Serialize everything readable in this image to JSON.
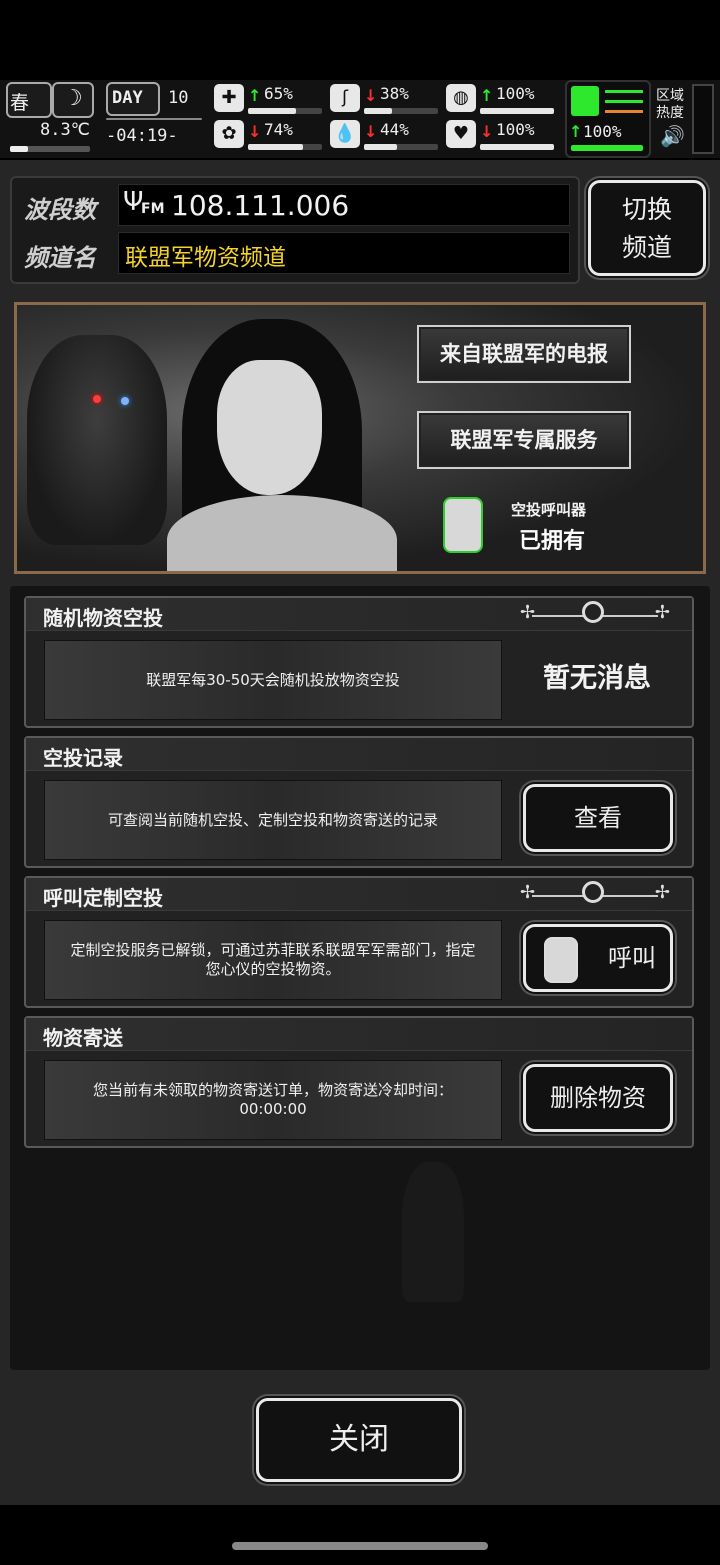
{
  "status": {
    "season": "春",
    "temperature": "8.3℃",
    "day_label": "DAY",
    "day_number": "10",
    "clock": "-04:19-",
    "stats": [
      {
        "icon": "medkit-icon",
        "trend": "up",
        "value": "65%",
        "level": 0.65
      },
      {
        "icon": "stomach-icon",
        "trend": "down",
        "value": "38%",
        "level": 0.38
      },
      {
        "icon": "armor-icon",
        "trend": "up",
        "value": "100%",
        "level": 1.0
      },
      {
        "icon": "brain-icon",
        "trend": "down",
        "value": "74%",
        "level": 0.74
      },
      {
        "icon": "water-drop-icon",
        "trend": "down",
        "value": "44%",
        "level": 0.44
      },
      {
        "icon": "heart-icon",
        "trend": "down",
        "value": "100%",
        "level": 1.0
      }
    ],
    "stamina": {
      "trend": "up",
      "value": "100%",
      "level": 1.0
    },
    "region_heat_label": "区域热度"
  },
  "radio": {
    "band_label": "波段数",
    "band_icon": "FM",
    "frequency": "108.111.006",
    "channel_label": "频道名",
    "channel_name": "联盟军物资频道",
    "switch_button": "切换频道"
  },
  "banner": {
    "telegram_button": "来自联盟军的电报",
    "service_button": "联盟军专属服务",
    "item_name": "空投呼叫器",
    "item_status": "已拥有"
  },
  "sections": [
    {
      "title": "随机物资空投",
      "desc": "联盟军每30-50天会随机投放物资空投",
      "action": "暂无消息"
    },
    {
      "title": "空投记录",
      "desc": "可查阅当前随机空投、定制空投和物资寄送的记录",
      "action": "查看"
    },
    {
      "title": "呼叫定制空投",
      "desc": "定制空投服务已解锁，可通过苏菲联系联盟军军需部门，指定您心仪的空投物资。",
      "action": "呼叫"
    },
    {
      "title": "物资寄送",
      "desc": "您当前有未领取的物资寄送订单，物资寄送冷却时间：00:00:00",
      "action": "删除物资"
    }
  ],
  "close_button": "关闭",
  "colors": {
    "accent_green": "#2ee82e",
    "alert_red": "#ff3030",
    "channel_yellow": "#f5d32a",
    "banner_border": "#8a6a4a"
  }
}
